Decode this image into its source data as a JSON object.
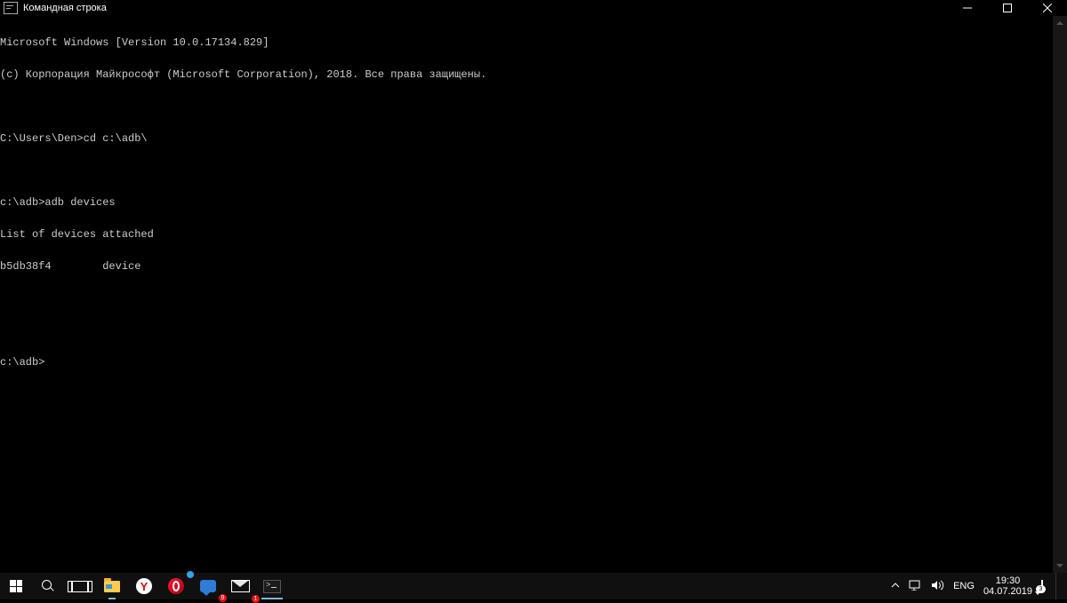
{
  "window": {
    "title": "Командная строка"
  },
  "terminal": {
    "lines": [
      "Microsoft Windows [Version 10.0.17134.829]",
      "(c) Корпорация Майкрософт (Microsoft Corporation), 2018. Все права защищены.",
      "",
      "C:\\Users\\Den>cd c:\\adb\\",
      "",
      "c:\\adb>adb devices",
      "List of devices attached",
      "b5db38f4        device",
      "",
      "",
      "c:\\adb>"
    ]
  },
  "taskbar": {
    "yandex_letter": "Y",
    "chat_badge": "9",
    "mail_badge": "1"
  },
  "tray": {
    "lang": "ENG",
    "time": "19:30",
    "date": "04.07.2019",
    "action_badge": "3"
  }
}
